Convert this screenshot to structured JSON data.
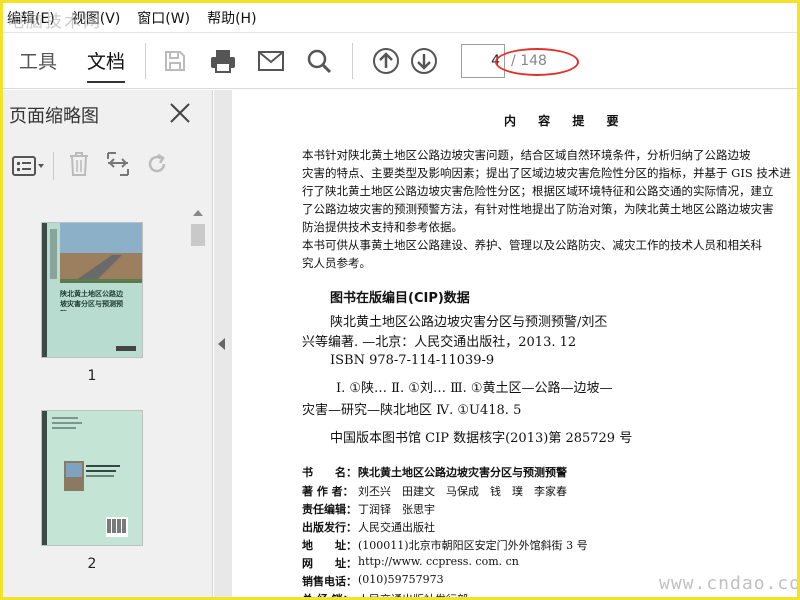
{
  "watermark": {
    "top": "电脑技术网",
    "bottom": "www.cndao.com"
  },
  "menu": [
    {
      "label": "编辑(E)"
    },
    {
      "label": "视图(V)"
    },
    {
      "label": "窗口(W)"
    },
    {
      "label": "帮助(H)"
    }
  ],
  "toolbar": {
    "tab_tools": "工具",
    "tab_document": "文档",
    "current_page": "4",
    "total_pages": "/ 148",
    "icons": [
      "save-icon",
      "print-icon",
      "mail-icon",
      "search-icon",
      "page-up-icon",
      "page-down-icon"
    ]
  },
  "sidebar": {
    "title": "页面缩略图",
    "thumbnails": [
      {
        "label": "1"
      },
      {
        "label": "2"
      }
    ],
    "cover_title": "陕北黄土地区公路边坡灾害分区与预测预警"
  },
  "document": {
    "heading": "内 容 提 要",
    "summary_lines": [
      "    本书针对陕北黄土地区公路边坡灾害问题，结合区域自然环境条件，分析归纳了公路边坡",
      "灾害的特点、主要类型及影响因素；提出了区域边坡灾害危险性分区的指标，并基于 GIS 技术进",
      "行了陕北黄土地区公路边坡灾害危险性分区；根据区域环境特征和公路交通的实际情况，建立",
      "了公路边坡灾害的预测预警方法，有针对性地提出了防治对策，为陕北黄土地区公路边坡灾害",
      "防治提供技术支持和参考依据。",
      "    本书可供从事黄土地区公路建设、养护、管理以及公路防灾、减灾工作的技术人员和相关科",
      "究人员参考。"
    ],
    "cip_title": "图书在版编目(CIP)数据",
    "cip_lines": [
      "陕北黄土地区公路边坡灾害分区与预测预警/刘丕",
      "兴等编著. —北京：人民交通出版社，2013. 12",
      "ISBN 978-7-114-11039-9",
      "Ⅰ. ①陕…  Ⅱ. ①刘…  Ⅲ. ①黄土区—公路—边坡—",
      "灾害—研究—陕北地区  Ⅳ. ①U418. 5",
      "中国版本图书馆 CIP 数据核字(2013)第 285729 号"
    ],
    "info": [
      {
        "label": "书　　名：",
        "value": "陕北黄土地区公路边坡灾害分区与预测预警",
        "bold": true
      },
      {
        "label": "著 作 者：",
        "value": "刘丕兴　田建文　马保成　钱　璞　李家春"
      },
      {
        "label": "责任编辑：",
        "value": "丁润铎　张思宇"
      },
      {
        "label": "出版发行：",
        "value": "人民交通出版社"
      },
      {
        "label": "地　　址：",
        "value": "(100011)北京市朝阳区安定门外外馆斜街 3 号"
      },
      {
        "label": "网　　址：",
        "value": "http://www. ccpress. com. cn"
      },
      {
        "label": "销售电话：",
        "value": "(010)59757973"
      },
      {
        "label": "总 经 销：",
        "value": "人民交通出版社发行部"
      }
    ]
  },
  "colors": {
    "highlight_oval": "#e0312a",
    "frame": "#f4e12a"
  }
}
